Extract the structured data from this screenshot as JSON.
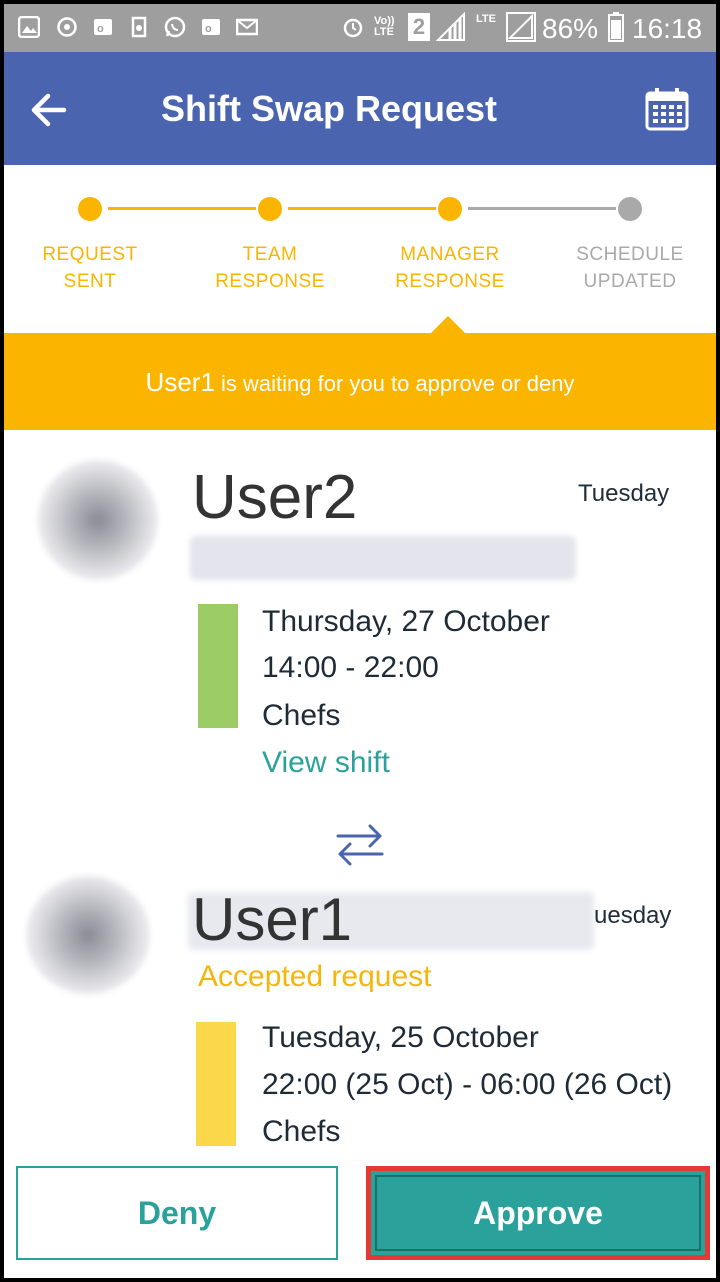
{
  "status_bar": {
    "network": "LTE",
    "volte": "Vo)) LTE",
    "sim": "2",
    "battery": "86%",
    "time": "16:18"
  },
  "app_bar": {
    "title": "Shift Swap Request",
    "back_icon": "arrow-left-icon",
    "calendar_icon": "calendar-icon"
  },
  "progress": {
    "steps": [
      {
        "label_line1": "REQUEST",
        "label_line2": "SENT",
        "state": "done"
      },
      {
        "label_line1": "TEAM",
        "label_line2": "RESPONSE",
        "state": "done"
      },
      {
        "label_line1": "MANAGER",
        "label_line2": "RESPONSE",
        "state": "current"
      },
      {
        "label_line1": "SCHEDULE",
        "label_line2": "UPDATED",
        "state": "pending"
      }
    ],
    "colors": {
      "active": "#fbb500",
      "inactive": "#a9a9a9"
    }
  },
  "banner": {
    "user": "User1",
    "message": " is waiting for you to approve or deny",
    "color": "#fbb500"
  },
  "requester": {
    "name": "User2",
    "day": "Tuesday",
    "shift": {
      "date": "Thursday, 27 October",
      "time": "14:00 - 22:00",
      "group": "Chefs",
      "color": "#9ccc65"
    },
    "view_shift_label": "View shift"
  },
  "swap_icon": "swap-arrows-icon",
  "responder": {
    "name": "User1",
    "day": "uesday",
    "status": "Accepted request",
    "shift": {
      "date": "Tuesday, 25 October",
      "time": "22:00 (25 Oct) - 06:00 (26 Oct)",
      "group": "Chefs",
      "color": "#fbd84a"
    }
  },
  "actions": {
    "deny_label": "Deny",
    "approve_label": "Approve",
    "accent": "#2aa19a"
  }
}
